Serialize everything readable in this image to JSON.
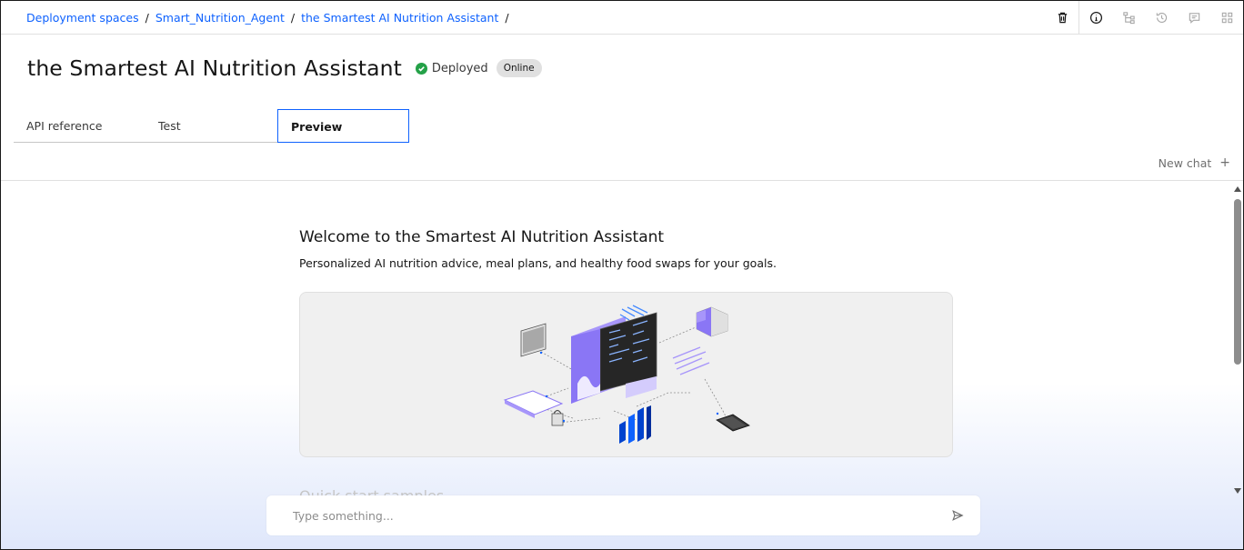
{
  "breadcrumb": {
    "items": [
      "Deployment spaces",
      "Smart_Nutrition_Agent",
      "the Smartest AI Nutrition Assistant"
    ],
    "separator": "/"
  },
  "toolbar": {
    "icons": [
      "trash-icon",
      "info-icon",
      "flow-icon",
      "history-icon",
      "chat-icon",
      "apps-icon"
    ]
  },
  "header": {
    "title": "the Smartest AI Nutrition Assistant",
    "status": "Deployed",
    "tag": "Online"
  },
  "tabs": [
    {
      "label": "API reference"
    },
    {
      "label": "Test"
    },
    {
      "label": "Preview"
    }
  ],
  "chat": {
    "new_chat": "New chat",
    "welcome_title": "Welcome to the Smartest AI Nutrition Assistant",
    "welcome_subtitle": "Personalized AI nutrition advice, meal plans, and healthy food swaps for your goals.",
    "quick_start": "Quick start samples",
    "input_placeholder": "Type something..."
  },
  "colors": {
    "link": "#0f62fe",
    "status_green": "#24a148",
    "accent_purple": "#8a76f5"
  }
}
